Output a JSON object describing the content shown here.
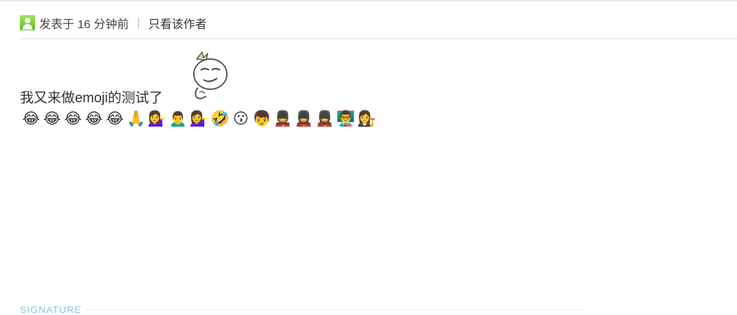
{
  "meta": {
    "posted_label": "发表于 16 分钟前",
    "separator": "|",
    "author_only_label": "只看该作者"
  },
  "post": {
    "text": "我又来做emoji的测试了",
    "emojis": [
      "😂",
      "😂",
      "😂",
      "😂",
      "😂",
      "🙏",
      "💁‍♀️",
      "🙍‍♂️",
      "💁‍♀️",
      "🤣",
      "😗",
      "👦",
      "💂",
      "💂‍♀️",
      "💂‍♀️",
      "👨‍🏫",
      "👩‍⚖️"
    ]
  },
  "signature": {
    "label": "SIGNATURE"
  }
}
